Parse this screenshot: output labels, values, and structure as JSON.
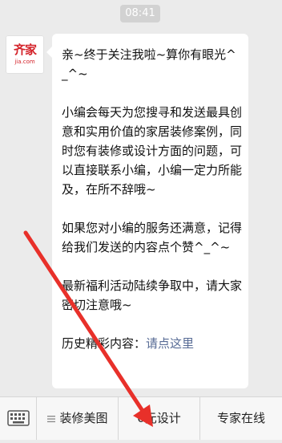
{
  "time_badge": "08:41",
  "avatar": {
    "logo_cn": "齐家",
    "logo_en": "jia.com"
  },
  "message": {
    "para1": "亲~终于关注我啦~算你有眼光^_^~",
    "para2": "小编会每天为您搜寻和发送最具创意和实用价值的家居装修案例，同时您有装修或设计方面的问题，可以直接联系小编，小编一定力所能及，在所不辞哦~",
    "para3": "如果您对小编的服务还满意，记得给我们发送的内容点个赞^_^~",
    "para4": "最新福利活动陆续争取中，请大家密切注意哦~",
    "history_label": "历史精彩内容：",
    "history_link": "请点这里"
  },
  "bottom_menu": {
    "items": [
      {
        "label": "装修美图",
        "has_submenu": true
      },
      {
        "label": "0元设计",
        "has_submenu": false
      },
      {
        "label": "专家在线",
        "has_submenu": false
      }
    ]
  },
  "colors": {
    "background": "#ebebeb",
    "link": "#576b95",
    "annotation_arrow": "#e8302a",
    "brand": "#d4232a"
  },
  "icons": {
    "keyboard": "keyboard-icon",
    "menu": "menu-list-icon",
    "arrow": "red-arrow-annotation"
  }
}
